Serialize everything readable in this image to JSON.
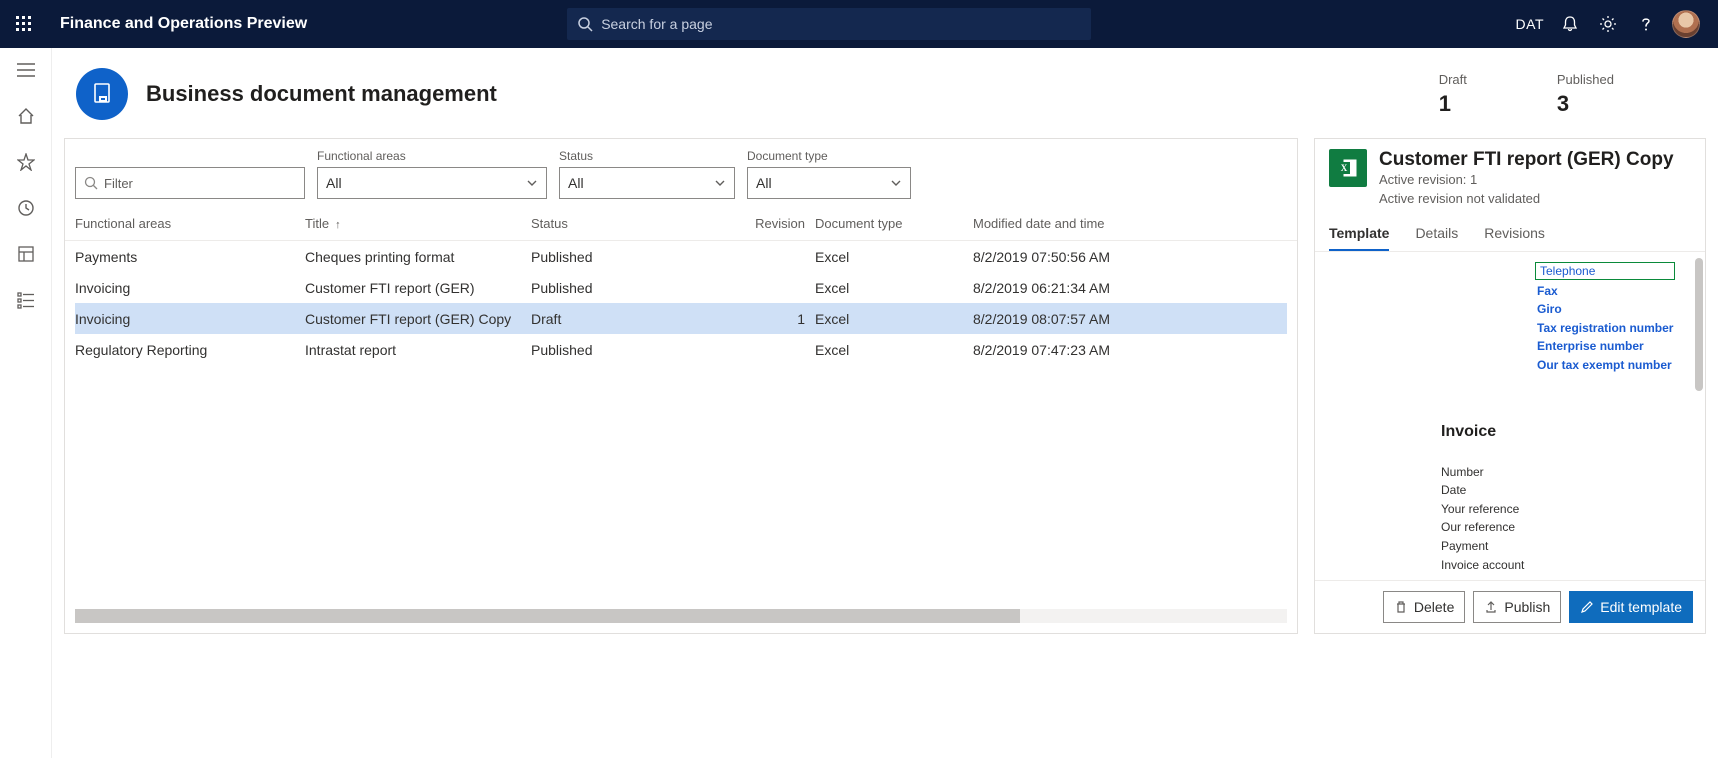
{
  "topbar": {
    "app_title": "Finance and Operations Preview",
    "search_placeholder": "Search for a page",
    "company": "DAT"
  },
  "page": {
    "title": "Business document management",
    "stats": {
      "draft_label": "Draft",
      "draft_value": "1",
      "published_label": "Published",
      "published_value": "3"
    }
  },
  "filters": {
    "filter_placeholder": "Filter",
    "functional_label": "Functional areas",
    "functional_value": "All",
    "status_label": "Status",
    "status_value": "All",
    "doctype_label": "Document type",
    "doctype_value": "All"
  },
  "grid": {
    "headers": {
      "functional": "Functional areas",
      "title": "Title",
      "status": "Status",
      "revision": "Revision",
      "doctype": "Document type",
      "modified": "Modified date and time"
    },
    "rows": [
      {
        "functional": "Payments",
        "title": "Cheques printing format",
        "status": "Published",
        "revision": "",
        "doctype": "Excel",
        "modified": "8/2/2019 07:50:56 AM",
        "selected": false
      },
      {
        "functional": "Invoicing",
        "title": "Customer FTI report (GER)",
        "status": "Published",
        "revision": "",
        "doctype": "Excel",
        "modified": "8/2/2019 06:21:34 AM",
        "selected": false
      },
      {
        "functional": "Invoicing",
        "title": "Customer FTI report (GER) Copy",
        "status": "Draft",
        "revision": "1",
        "doctype": "Excel",
        "modified": "8/2/2019 08:07:57 AM",
        "selected": true
      },
      {
        "functional": "Regulatory Reporting",
        "title": "Intrastat report",
        "status": "Published",
        "revision": "",
        "doctype": "Excel",
        "modified": "8/2/2019 07:47:23 AM",
        "selected": false
      }
    ]
  },
  "details": {
    "title": "Customer FTI report (GER) Copy",
    "sub1": "Active revision: 1",
    "sub2": "Active revision not validated",
    "tabs": {
      "template": "Template",
      "details": "Details",
      "revisions": "Revisions"
    },
    "preview": {
      "telephone": "Telephone",
      "blue_links": [
        "Fax",
        "Giro",
        "Tax registration number",
        "Enterprise number",
        "Our tax exempt number"
      ],
      "invoice_heading": "Invoice",
      "fields": [
        "Number",
        "Date",
        "Your reference",
        "Our reference",
        "Payment",
        "Invoice account"
      ]
    },
    "actions": {
      "delete": "Delete",
      "publish": "Publish",
      "edit": "Edit template"
    }
  }
}
